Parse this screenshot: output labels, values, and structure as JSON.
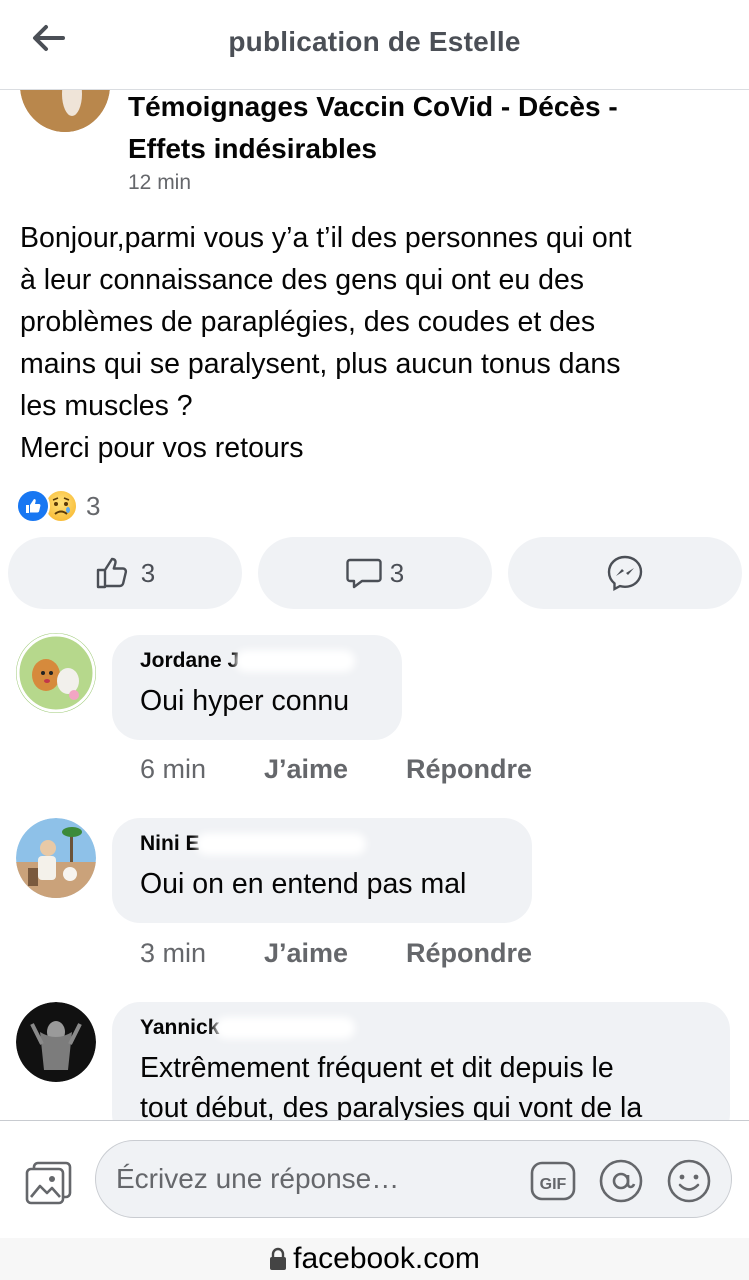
{
  "header": {
    "title": "publication de Estelle"
  },
  "post": {
    "group_name_line1": "Témoignages Vaccin CoVid - Décès -",
    "group_name_line2": "Effets indésirables",
    "time": "12 min",
    "body_lines": [
      "Bonjour,parmi vous y’a t’il des personnes qui ont",
      "à leur connaissance des gens qui ont eu des",
      "problèmes de paraplégies, des coudes et des",
      "mains qui se paralysent, plus aucun tonus dans",
      "les muscles ?",
      "Merci pour vos retours"
    ],
    "reaction_count": "3",
    "like_count": "3",
    "comment_count": "3"
  },
  "comments": [
    {
      "author": "Jordane J",
      "text": "Oui hyper connu",
      "time": "6 min",
      "like_label": "J’aime",
      "reply_label": "Répondre"
    },
    {
      "author": "Nini E",
      "text": "Oui on en entend pas mal",
      "time": "3 min",
      "like_label": "J’aime",
      "reply_label": "Répondre"
    },
    {
      "author": "Yannick",
      "text_line1": "Extrêmement fréquent et dit depuis le",
      "text_line2": "tout début, des paralysies qui vont de la"
    }
  ],
  "composer": {
    "placeholder": "Écrivez une réponse…",
    "gif_label": "GIF"
  },
  "browser": {
    "domain": "facebook.com"
  },
  "icons": {
    "back": "arrow-left-icon",
    "like": "thumbs-up-icon",
    "comment": "speech-bubble-icon",
    "messenger": "messenger-icon",
    "photo": "photo-icon",
    "gif": "gif-icon",
    "mention": "at-sign-icon",
    "emoji": "smiley-icon",
    "lock": "lock-icon"
  },
  "colors": {
    "accent": "#1877f2",
    "secondary_text": "#65676b",
    "bubble": "#f0f2f5"
  }
}
